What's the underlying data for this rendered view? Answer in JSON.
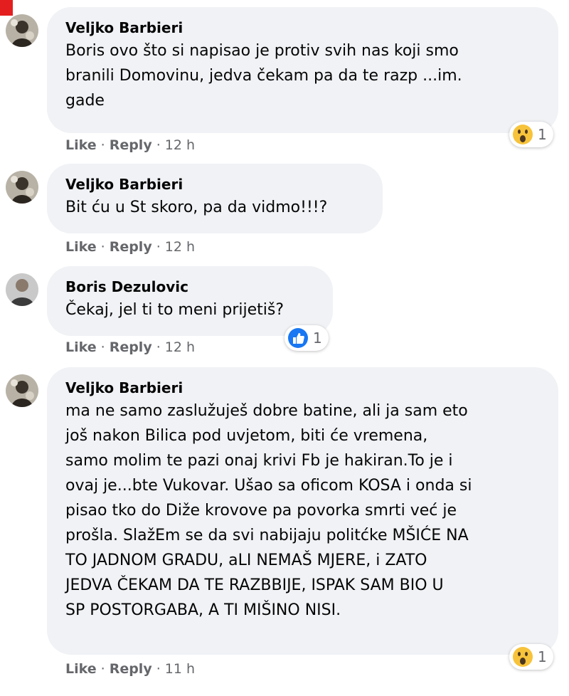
{
  "comments": [
    {
      "author": "Veljko Barbieri",
      "text": "Boris ovo što si napisao je protiv svih nas koji smo\nbranili Domovinu, jedva čekam pa da te razp ...im.\ngade",
      "actions": {
        "like": "Like",
        "reply": "Reply",
        "time": "12 h"
      },
      "reaction": {
        "icon": "wow-emoji-icon",
        "count": "1"
      }
    },
    {
      "author": "Veljko Barbieri",
      "text": "Bit ću u St skoro, pa da vidmo!!!?",
      "actions": {
        "like": "Like",
        "reply": "Reply",
        "time": "12 h"
      }
    },
    {
      "author": "Boris Dezulovic",
      "text": "Čekaj, jel ti to meni prijetiš?",
      "actions": {
        "like": "Like",
        "reply": "Reply",
        "time": "12 h"
      },
      "reaction": {
        "icon": "like-thumb-icon",
        "count": "1"
      }
    },
    {
      "author": "Veljko Barbieri",
      "text": "ma ne samo zaslužuješ dobre batine, ali ja sam eto\njoš nakon Bilica pod uvjetom, biti će vremena,\nsamo molim te pazi onaj krivi Fb je hakiran.To je i\novaj je...bte Vukovar. Ušao sa oficom KOSA i onda si\npisao tko do Diže krovove pa povorka smrti već je\nprošla. SlažEm se da svi nabijaju politćke MŠIĆE NA\nTO JADNOM GRADU, aLI NEMAŠ MJERE, i ZATO\nJEDVA ČEKAM DA TE RAZBBIJE, ISPAK SAM BIO U\nSP POSTORGABA, A TI MIŠINO NISI.",
      "actions": {
        "like": "Like",
        "reply": "Reply",
        "time": "11 h"
      },
      "reaction": {
        "icon": "wow-emoji-icon",
        "count": "1"
      }
    }
  ],
  "colors": {
    "bubble": "#f0f2f5",
    "meta": "#65676b",
    "like_blue": "#1877f2",
    "wow_yellow": "#f7c33b",
    "corner": "#e41e1e"
  }
}
